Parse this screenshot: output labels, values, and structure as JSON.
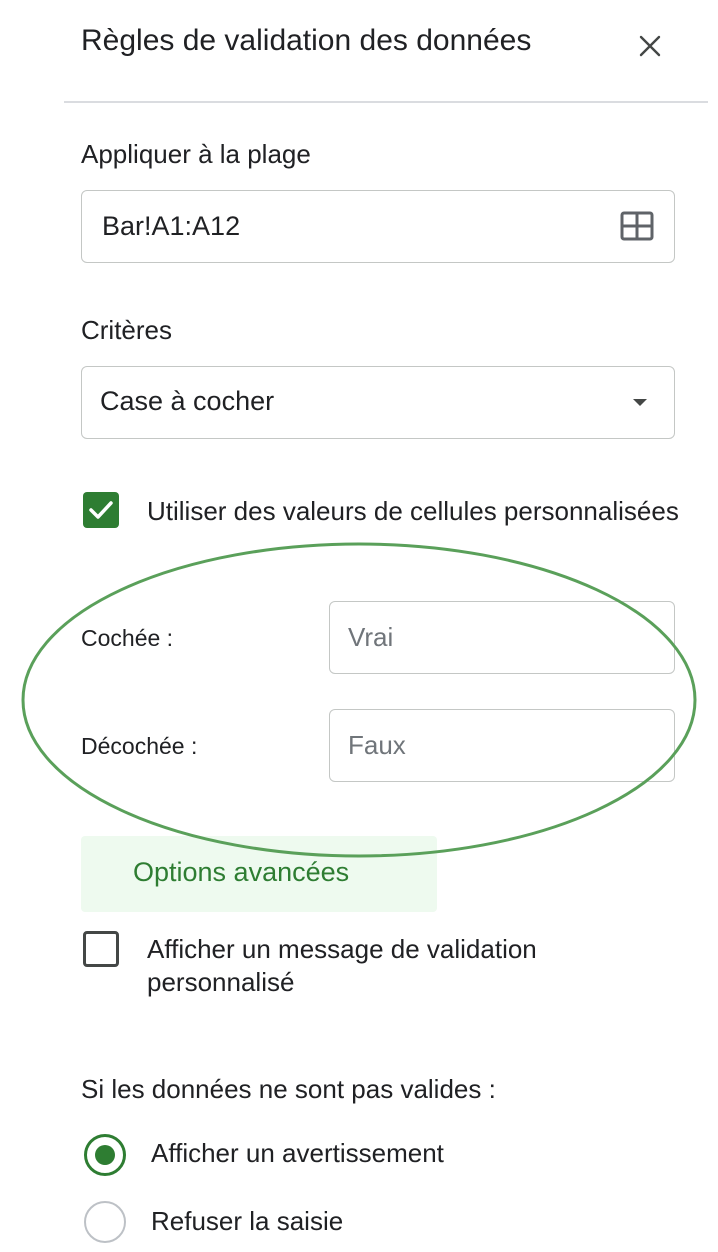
{
  "header": {
    "title": "Règles de validation des données"
  },
  "range": {
    "label": "Appliquer à la plage",
    "value": "Bar!A1:A12"
  },
  "criteria": {
    "label": "Critères",
    "selected": "Case à cocher"
  },
  "custom_values": {
    "checkbox_checked": true,
    "label": "Utiliser des valeurs de cellules personnalisées",
    "checked_label": "Cochée :",
    "checked_placeholder": "Vrai",
    "unchecked_label": "Décochée :",
    "unchecked_placeholder": "Faux"
  },
  "advanced": {
    "label": "Options avancées"
  },
  "custom_message": {
    "checkbox_checked": false,
    "label": "Afficher un message de validation personnalisé"
  },
  "invalid_data": {
    "label": "Si les données ne sont pas valides :",
    "options": [
      {
        "label": "Afficher un avertissement",
        "selected": true
      },
      {
        "label": "Refuser la saisie",
        "selected": false
      }
    ]
  },
  "colors": {
    "accent": "#2e7d32",
    "highlight_annotation": "#5aa05a"
  }
}
